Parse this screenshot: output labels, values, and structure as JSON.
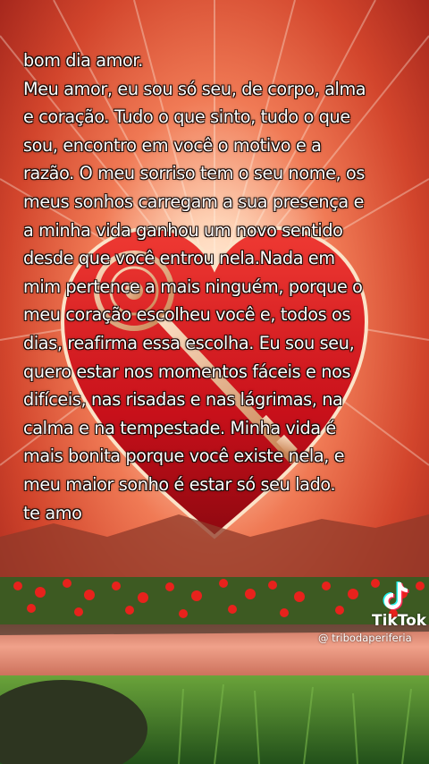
{
  "message": {
    "lines": [
      "bom dia amor.",
      "Meu amor, eu sou só seu, de corpo, alma",
      "e coração. Tudo o que sinto, tudo o que",
      "sou, encontro em você o motivo e a",
      "razão. O meu sorriso tem o seu nome, os",
      "meus sonhos carregam a sua presença e",
      "a minha vida ganhou um novo sentido",
      "desde que você entrou nela.Nada em",
      "mim pertence a mais ninguém, porque o",
      "meu coração escolheu você e, todos os",
      "dias, reafirma essa escolha. Eu sou seu,",
      "quero estar nos momentos fáceis e nos",
      "difíceis, nas risadas e nas lágrimas, na",
      "calma e na tempestade. Minha vida é",
      "mais bonita porque você existe nela, e",
      "meu maior sonho é estar só seu lado.",
      "te amo"
    ]
  },
  "watermark": {
    "brand": "TikTok",
    "handle": "@ tribodaperiferia",
    "icon": "tiktok-logo-icon"
  },
  "colors": {
    "sky_top": "#c8322a",
    "sky_glow": "#ffe6cf",
    "heart": "#d4141c",
    "water": "#e07860",
    "grass": "#3f7d22"
  }
}
